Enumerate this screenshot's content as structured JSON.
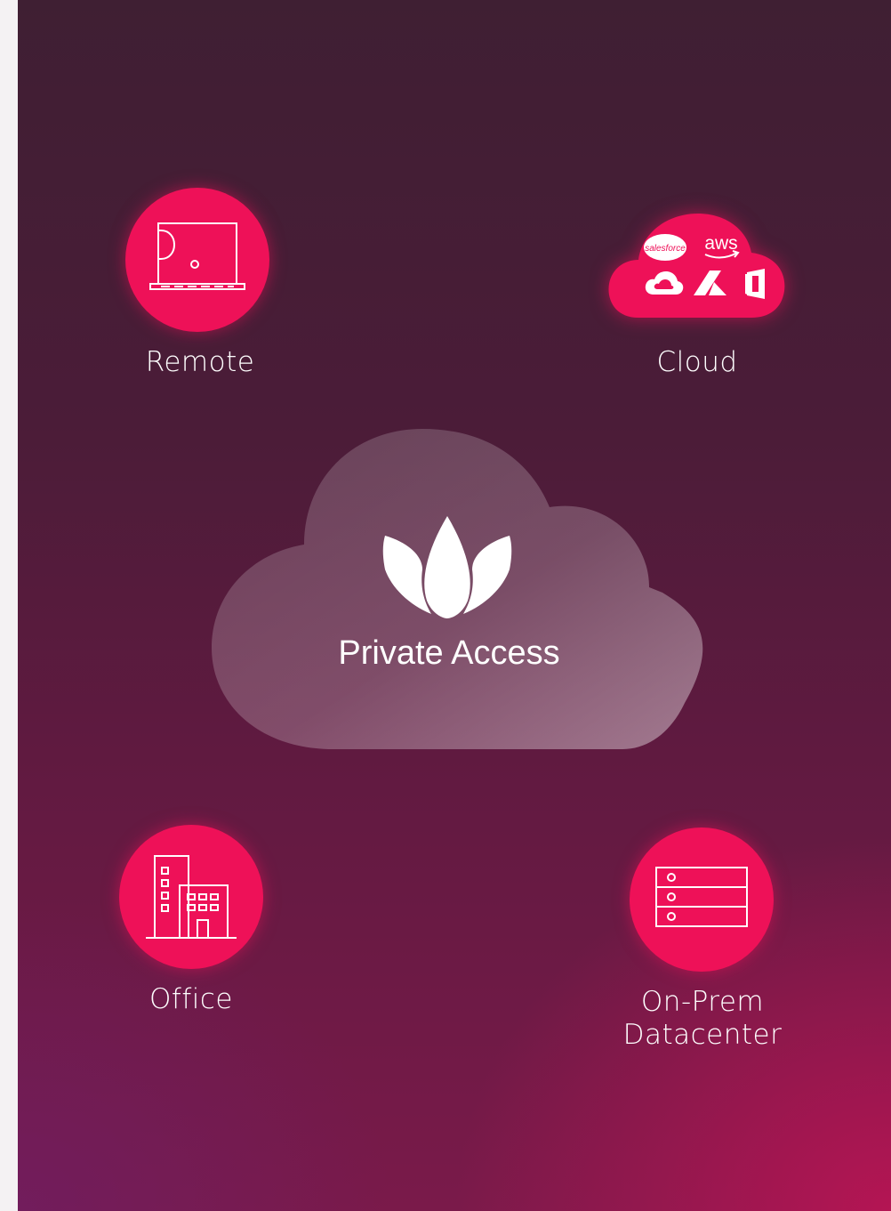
{
  "center": {
    "title": "Private Access",
    "logo_icon": "lotus-logo-icon"
  },
  "nodes": {
    "remote": {
      "label": "Remote",
      "icon": "laptop-icon"
    },
    "cloud": {
      "label": "Cloud",
      "icon": "cloud-services-icon",
      "brands": {
        "salesforce": "salesforce",
        "aws": "aws"
      }
    },
    "office": {
      "label": "Office",
      "icon": "office-building-icon"
    },
    "datacenter": {
      "label_line1": "On-Prem",
      "label_line2": "Datacenter",
      "icon": "server-rack-icon"
    }
  },
  "colors": {
    "accent": "#ee1158",
    "background_top": "#3f1f33",
    "background_bottom": "#8a1850",
    "text": "#ffffff"
  }
}
